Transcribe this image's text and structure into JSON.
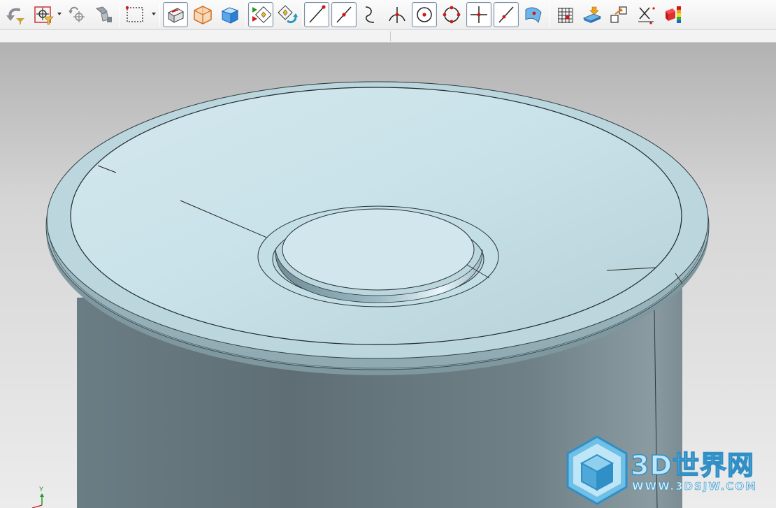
{
  "toolbar": {
    "buttons": [
      {
        "name": "undo-filter-icon",
        "pressed": false
      },
      {
        "name": "selection-filter-icon",
        "pressed": false
      },
      {
        "name": "snap-point-icon",
        "pressed": false
      },
      {
        "name": "rotate-view-icon",
        "pressed": false
      },
      {
        "name": "box-select-icon",
        "pressed": false
      },
      {
        "name": "face-render-icon",
        "pressed": true
      },
      {
        "name": "wireframe-cube-icon",
        "pressed": false
      },
      {
        "name": "shaded-cube-icon",
        "pressed": false
      },
      {
        "name": "snap-points-enabled-icon",
        "pressed": true
      },
      {
        "name": "snap-points-cycle-icon",
        "pressed": false
      },
      {
        "name": "end-point-icon",
        "pressed": true
      },
      {
        "name": "mid-point-icon",
        "pressed": true
      },
      {
        "name": "control-point-icon",
        "pressed": false
      },
      {
        "name": "intersection-point-icon",
        "pressed": false
      },
      {
        "name": "arc-center-icon",
        "pressed": true
      },
      {
        "name": "quadrant-point-icon",
        "pressed": false
      },
      {
        "name": "existing-point-icon",
        "pressed": true
      },
      {
        "name": "point-on-curve-icon",
        "pressed": true
      },
      {
        "name": "point-on-surface-icon",
        "pressed": false
      },
      {
        "name": "grid-icon",
        "pressed": false
      },
      {
        "name": "work-plane-icon",
        "pressed": false
      },
      {
        "name": "move-to-layer-icon",
        "pressed": false
      },
      {
        "name": "measure-distance-icon",
        "pressed": false
      },
      {
        "name": "face-analysis-icon",
        "pressed": false
      }
    ]
  },
  "viewport": {
    "triad_label": "Y"
  },
  "watermark": {
    "title": "3D世界网",
    "url": "WWW.3DSJW.COM"
  },
  "colors": {
    "body_side": "#5f6e74",
    "top_face": "#c9e0e6",
    "edge": "#1e2a30",
    "accent_red": "#d01818",
    "watermark_blue": "#2f8fc6"
  }
}
